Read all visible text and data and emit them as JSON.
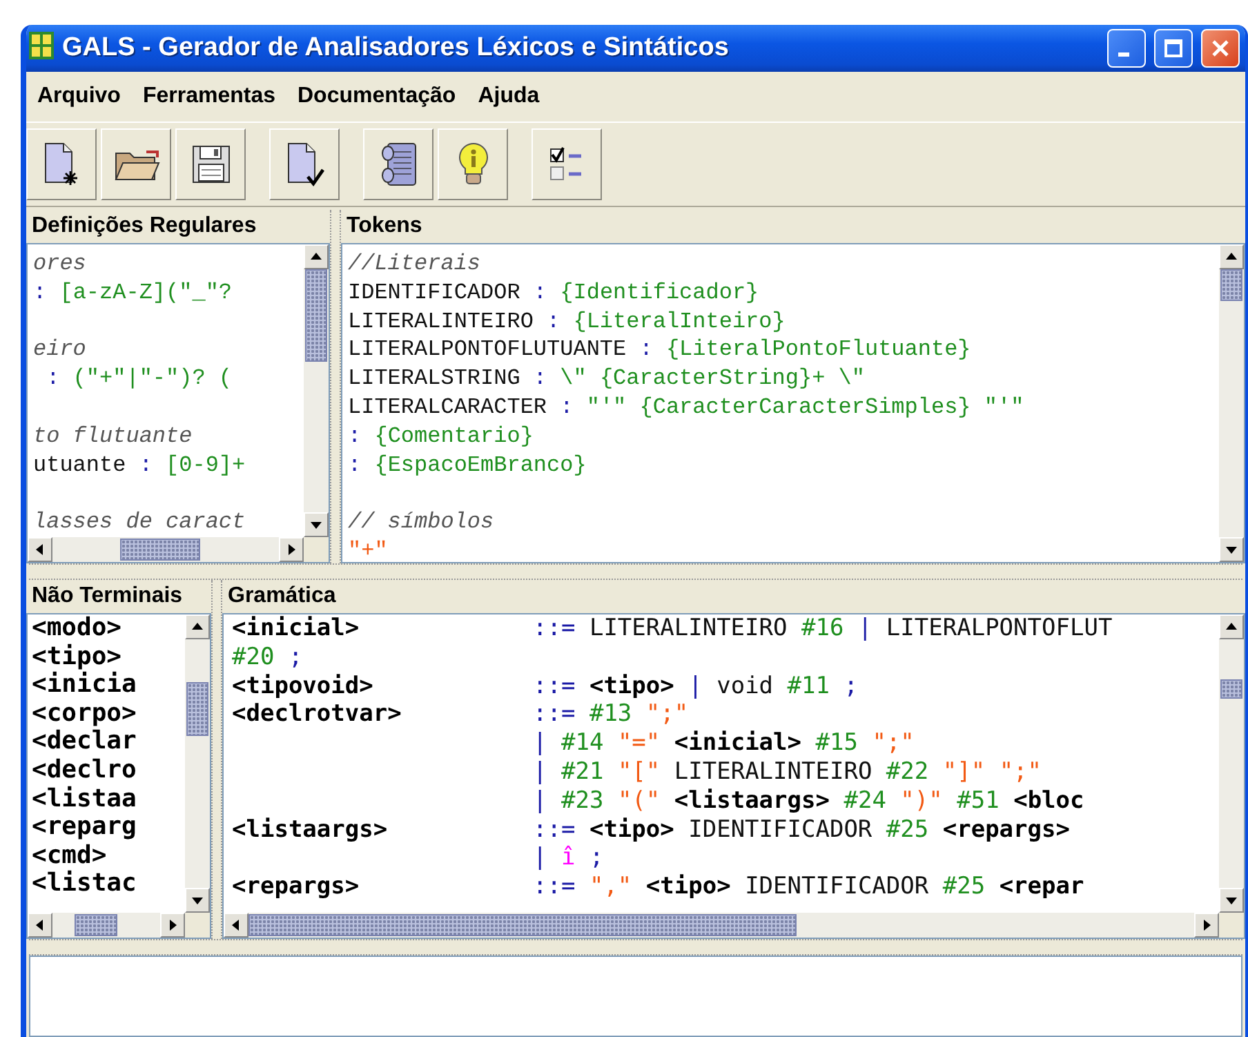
{
  "window": {
    "title": "GALS - Gerador de Analisadores Léxicos e Sintáticos"
  },
  "menu": [
    "Arquivo",
    "Ferramentas",
    "Documentação",
    "Ajuda"
  ],
  "toolbar": [
    {
      "buttons": [
        {
          "kind": "new"
        },
        {
          "kind": "open"
        },
        {
          "kind": "save"
        }
      ]
    },
    {
      "buttons": [
        {
          "kind": "verify"
        }
      ]
    },
    {
      "buttons": [
        {
          "kind": "notebook"
        },
        {
          "kind": "info"
        }
      ]
    },
    {
      "buttons": [
        {
          "kind": "options"
        }
      ]
    }
  ],
  "regular_definitions": {
    "title": "Definições Regulares",
    "lines": [
      {
        "segments": [
          {
            "kind": "comment",
            "text": "ores"
          }
        ]
      },
      {
        "segments": [
          {
            "kind": "op",
            "text": ":"
          },
          {
            "kind": "action",
            "text": " [a-zA-Z](\"_\"?"
          }
        ]
      },
      {
        "space_before": true,
        "segments": [
          {
            "kind": "comment",
            "text": "eiro"
          }
        ]
      },
      {
        "segments": [
          {
            "kind": "op",
            "text": " :"
          },
          {
            "kind": "action",
            "text": " (\"+\"|\"-\")? ("
          }
        ]
      },
      {
        "space_before": true,
        "segments": [
          {
            "kind": "comment",
            "text": "to flutuante"
          }
        ]
      },
      {
        "segments": [
          {
            "kind": "plain",
            "text": "utuante"
          },
          {
            "kind": "op",
            "text": " :"
          },
          {
            "kind": "action",
            "text": " [0-9]+"
          }
        ]
      },
      {
        "space_before": true,
        "segments": [
          {
            "kind": "comment",
            "text": "lasses de caract"
          }
        ]
      }
    ]
  },
  "tokens": {
    "title": "Tokens",
    "lines": [
      {
        "segments": [
          {
            "kind": "comment",
            "text": "//Literais"
          }
        ]
      },
      {
        "segments": [
          {
            "kind": "plain",
            "text": "IDENTIFICADOR"
          },
          {
            "kind": "op",
            "text": " :"
          },
          {
            "kind": "action",
            "text": " {Identificador}"
          }
        ]
      },
      {
        "segments": [
          {
            "kind": "plain",
            "text": "LITERALINTEIRO"
          },
          {
            "kind": "op",
            "text": " :"
          },
          {
            "kind": "action",
            "text": " {LiteralInteiro}"
          }
        ]
      },
      {
        "segments": [
          {
            "kind": "plain",
            "text": "LITERALPONTOFLUTUANTE"
          },
          {
            "kind": "op",
            "text": " :"
          },
          {
            "kind": "action",
            "text": " {LiteralPontoFlutuante}"
          }
        ]
      },
      {
        "segments": [
          {
            "kind": "plain",
            "text": "LITERALSTRING"
          },
          {
            "kind": "op",
            "text": " :"
          },
          {
            "kind": "action",
            "text": " \\\" {CaracterString}+ \\\""
          }
        ]
      },
      {
        "segments": [
          {
            "kind": "plain",
            "text": "LITERALCARACTER"
          },
          {
            "kind": "op",
            "text": " :"
          },
          {
            "kind": "action",
            "text": " \"'\" {CaracterCaracterSimples} \"'\""
          }
        ]
      },
      {
        "segments": [
          {
            "kind": "op",
            "text": ":"
          },
          {
            "kind": "action",
            "text": " {Comentario}"
          }
        ]
      },
      {
        "segments": [
          {
            "kind": "op",
            "text": ":"
          },
          {
            "kind": "action",
            "text": " {EspacoEmBranco}"
          }
        ]
      },
      {
        "space_before": true,
        "segments": [
          {
            "kind": "comment",
            "text": "// símbolos"
          }
        ]
      },
      {
        "segments": [
          {
            "kind": "string",
            "text": "\"+\""
          }
        ]
      }
    ]
  },
  "non_terminals": {
    "title": "Não Terminais",
    "items": [
      "<modo>",
      "<tipo>",
      "<inicia",
      "<corpo>",
      "<declar",
      "<declro",
      "<listaa",
      "<reparg",
      "<cmd>",
      "<listac"
    ]
  },
  "grammar": {
    "title": "Gramática",
    "rows": [
      {
        "kind": "rule",
        "head": "<inicial>",
        "segments": [
          {
            "kind": "op",
            "text": "::="
          },
          {
            "kind": "plain",
            "text": " LITERALINTEIRO "
          },
          {
            "kind": "action",
            "text": "#16"
          },
          {
            "kind": "op",
            "text": " | "
          },
          {
            "kind": "plain",
            "text": "LITERALPONTOFLUT"
          }
        ]
      },
      {
        "kind": "wrap",
        "segments": [
          {
            "kind": "action",
            "text": "#20"
          },
          {
            "kind": "op",
            "text": " ;"
          }
        ]
      },
      {
        "kind": "rule",
        "head": "<tipovoid>",
        "segments": [
          {
            "kind": "op",
            "text": "::="
          },
          {
            "kind": "nonterminal",
            "text": " <tipo>"
          },
          {
            "kind": "op",
            "text": " |"
          },
          {
            "kind": "plain",
            "text": " void "
          },
          {
            "kind": "action",
            "text": "#11"
          },
          {
            "kind": "op",
            "text": " ;"
          }
        ]
      },
      {
        "kind": "rule",
        "head": "<declrotvar>",
        "segments": [
          {
            "kind": "op",
            "text": "::="
          },
          {
            "kind": "action",
            "text": " #13"
          },
          {
            "kind": "string",
            "text": " \";\""
          }
        ]
      },
      {
        "kind": "alt",
        "segments": [
          {
            "kind": "op",
            "text": "|"
          },
          {
            "kind": "action",
            "text": " #14"
          },
          {
            "kind": "string",
            "text": " \"=\""
          },
          {
            "kind": "nonterminal",
            "text": " <inicial>"
          },
          {
            "kind": "action",
            "text": " #15"
          },
          {
            "kind": "string",
            "text": " \";\""
          }
        ]
      },
      {
        "kind": "alt",
        "segments": [
          {
            "kind": "op",
            "text": "|"
          },
          {
            "kind": "action",
            "text": " #21"
          },
          {
            "kind": "string",
            "text": " \"[\""
          },
          {
            "kind": "plain",
            "text": " LITERALINTEIRO "
          },
          {
            "kind": "action",
            "text": "#22"
          },
          {
            "kind": "string",
            "text": " \"]\" \";\""
          }
        ]
      },
      {
        "kind": "alt",
        "segments": [
          {
            "kind": "op",
            "text": "|"
          },
          {
            "kind": "action",
            "text": " #23"
          },
          {
            "kind": "string",
            "text": " \"(\""
          },
          {
            "kind": "nonterminal",
            "text": " <listaargs>"
          },
          {
            "kind": "action",
            "text": " #24"
          },
          {
            "kind": "string",
            "text": " \")\""
          },
          {
            "kind": "action",
            "text": " #51"
          },
          {
            "kind": "nonterminal",
            "text": " <bloc"
          }
        ]
      },
      {
        "kind": "rule",
        "head": "<listaargs>",
        "segments": [
          {
            "kind": "op",
            "text": "::="
          },
          {
            "kind": "nonterminal",
            "text": " <tipo>"
          },
          {
            "kind": "plain",
            "text": " IDENTIFICADOR "
          },
          {
            "kind": "action",
            "text": "#25"
          },
          {
            "kind": "nonterminal",
            "text": " <repargs>"
          }
        ]
      },
      {
        "kind": "alt",
        "segments": [
          {
            "kind": "op",
            "text": "|"
          },
          {
            "kind": "epsilon",
            "text": " î"
          },
          {
            "kind": "op",
            "text": " ;"
          }
        ]
      },
      {
        "kind": "rule",
        "head": "<repargs>",
        "segments": [
          {
            "kind": "op",
            "text": "::="
          },
          {
            "kind": "string",
            "text": " \",\""
          },
          {
            "kind": "nonterminal",
            "text": " <tipo>"
          },
          {
            "kind": "plain",
            "text": " IDENTIFICADOR "
          },
          {
            "kind": "action",
            "text": "#25"
          },
          {
            "kind": "nonterminal",
            "text": " <repar"
          }
        ]
      }
    ]
  }
}
